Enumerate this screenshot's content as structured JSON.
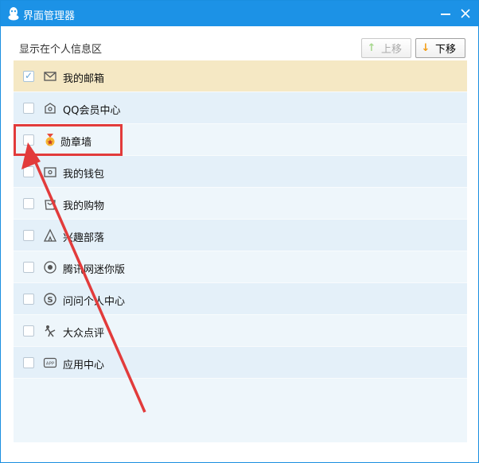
{
  "window": {
    "title": "界面管理器"
  },
  "section_label": "显示在个人信息区",
  "buttons": {
    "move_up": "上移",
    "move_down": "下移"
  },
  "items": [
    {
      "label": "我的邮箱",
      "icon": "mail-icon",
      "checked": true,
      "selected": true
    },
    {
      "label": "QQ会员中心",
      "icon": "vip-icon",
      "checked": false
    },
    {
      "label": "勋章墙",
      "icon": "medal-icon",
      "checked": false
    },
    {
      "label": "我的钱包",
      "icon": "wallet-icon",
      "checked": false
    },
    {
      "label": "我的购物",
      "icon": "shopping-bag-icon",
      "checked": false
    },
    {
      "label": "兴趣部落",
      "icon": "tribe-icon",
      "checked": false
    },
    {
      "label": "腾讯网迷你版",
      "icon": "tencent-news-icon",
      "checked": false
    },
    {
      "label": "问问个人中心",
      "icon": "wenwen-icon",
      "checked": false
    },
    {
      "label": "大众点评",
      "icon": "dianping-icon",
      "checked": false
    },
    {
      "label": "应用中心",
      "icon": "app-center-icon",
      "checked": false
    }
  ],
  "colors": {
    "titlebar": "#1c92e6",
    "annotation": "#e23b3b",
    "selected_row": "#f5e8c4"
  }
}
